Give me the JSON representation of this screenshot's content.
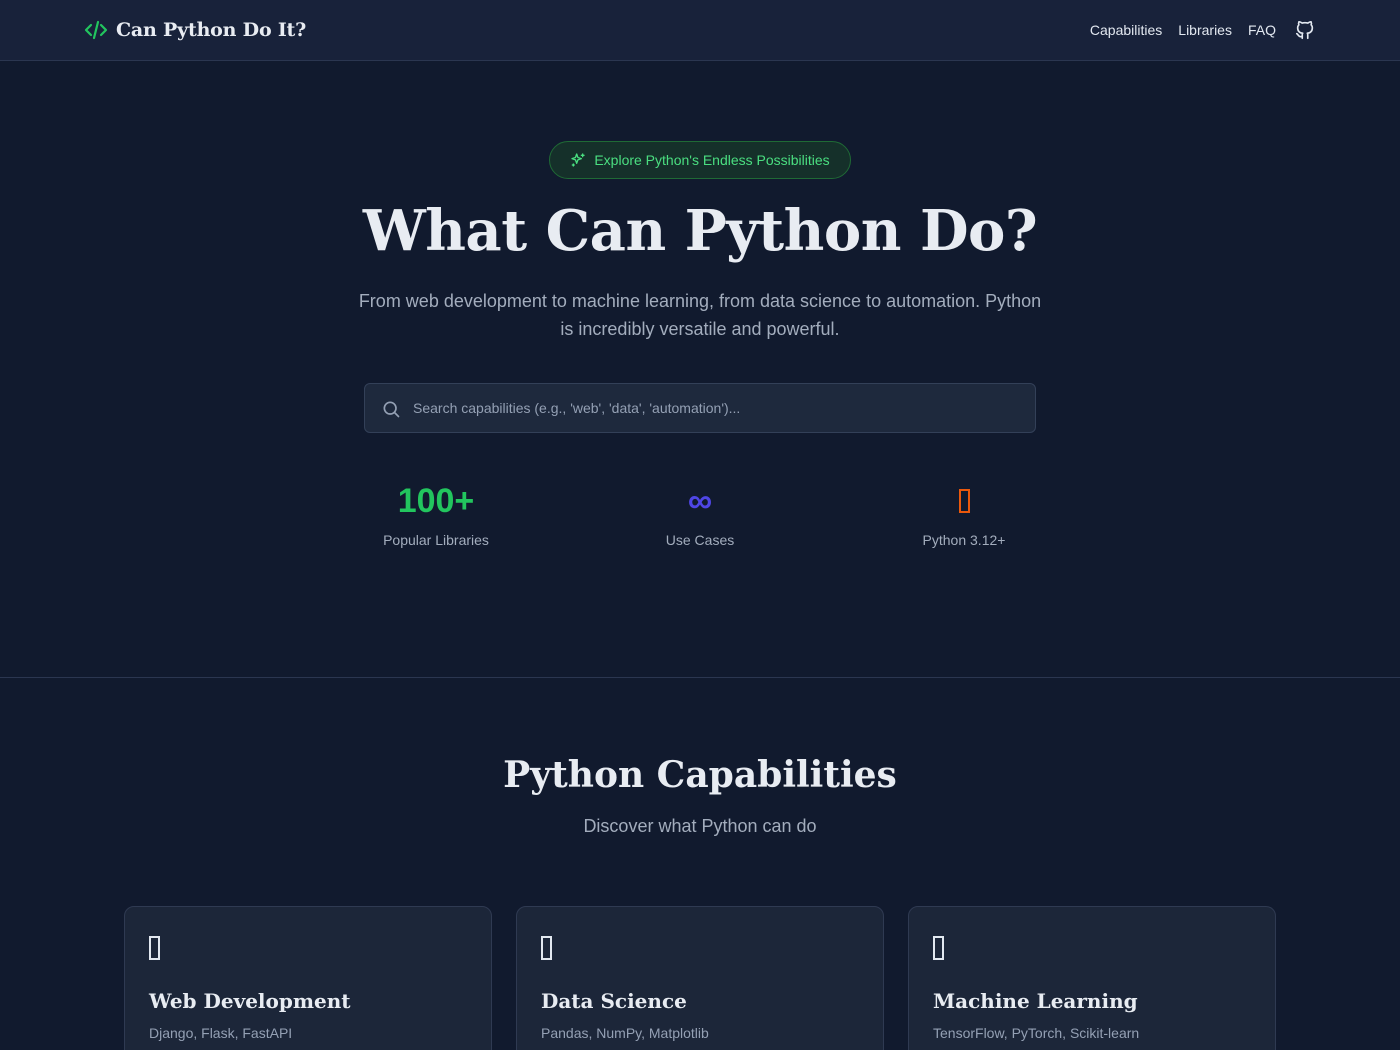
{
  "brand": {
    "title": "Can Python Do It?",
    "icon": "code-icon"
  },
  "nav": {
    "links": [
      "Capabilities",
      "Libraries",
      "FAQ"
    ],
    "github_icon": "github-icon"
  },
  "hero": {
    "badge": "Explore Python's Endless Possibilities",
    "badge_icon": "sparkles-icon",
    "title": "What Can Python Do?",
    "subtitle": "From web development to machine learning, from data science to automation. Python is incredibly versatile and powerful.",
    "search": {
      "placeholder": "Search capabilities (e.g., 'web', 'data', 'automation')...",
      "value": ""
    },
    "stats": [
      {
        "value": "100+",
        "label": "Popular Libraries",
        "color": "#22c55e"
      },
      {
        "value": "∞",
        "label": "Use Cases",
        "color": "#4f46e5"
      },
      {
        "value": "",
        "label": "Python 3.12+",
        "color": "#ea580c",
        "icon": "missing-glyph-icon"
      }
    ]
  },
  "capabilities": {
    "title": "Python Capabilities",
    "subtitle": "Discover what Python can do",
    "cards": [
      {
        "title": "Web Development",
        "libraries": "Django, Flask, FastAPI",
        "icon": "missing-glyph-icon"
      },
      {
        "title": "Data Science",
        "libraries": "Pandas, NumPy, Matplotlib",
        "icon": "missing-glyph-icon"
      },
      {
        "title": "Machine Learning",
        "libraries": "TensorFlow, PyTorch, Scikit-learn",
        "icon": "missing-glyph-icon"
      }
    ]
  },
  "colors": {
    "background": "#111a2e",
    "navbar": "#18223a",
    "accent_green": "#4ade80",
    "card": "#1c2639"
  }
}
